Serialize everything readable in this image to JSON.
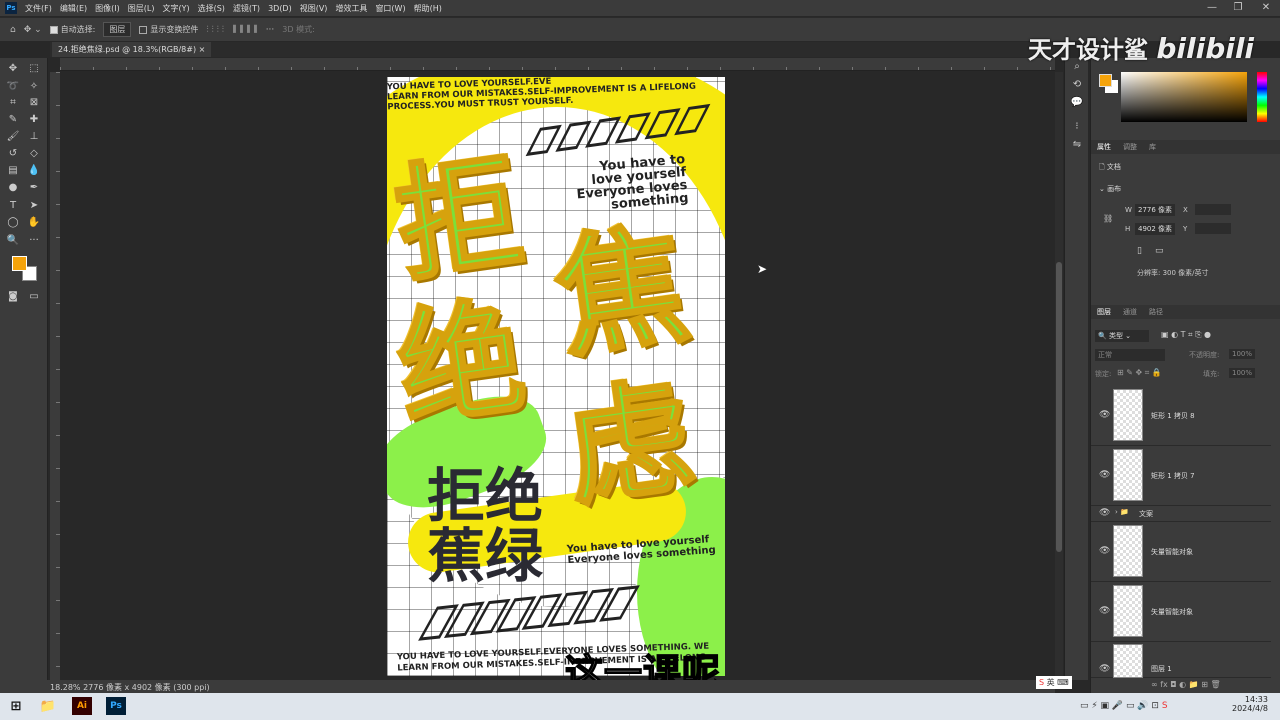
{
  "app": {
    "logo": "Ps"
  },
  "menu": [
    "文件(F)",
    "编辑(E)",
    "图像(I)",
    "图层(L)",
    "文字(Y)",
    "选择(S)",
    "滤镜(T)",
    "3D(D)",
    "视图(V)",
    "增效工具",
    "窗口(W)",
    "帮助(H)"
  ],
  "window_controls": {
    "minimize": "—",
    "restore": "❐",
    "close": "✕"
  },
  "options": {
    "auto_select_label": "自动选择:",
    "auto_select_checked": true,
    "auto_select_target": "图层",
    "show_transform_label": "显示变换控件",
    "show_transform_checked": false,
    "more": "···",
    "mode_3d": "3D 模式:"
  },
  "document_tab": {
    "title": "24.拒绝焦绿.psd @ 18.3%(RGB/8#)",
    "close": "×"
  },
  "artwork": {
    "top_text": [
      "YOU HAVE TO LOVE YOURSELF.EVE",
      "LEARN FROM OUR MISTAKES.SELF-IMPROVEMENT IS A LIFELONG",
      "PROCESS.YOU MUST TRUST YOURSELF."
    ],
    "right_text": [
      "You have to",
      "love yourself",
      "Everyone loves",
      "something"
    ],
    "big_chars": [
      "拒",
      "绝",
      "焦",
      "虑"
    ],
    "dark_title": [
      "拒绝",
      "蕉绿"
    ],
    "mid_text": [
      "You have to love yourself",
      "Everyone loves something"
    ],
    "bottom_text": [
      "YOU HAVE TO LOVE YOURSELF.EVERYONE LOVES SOMETHING. WE",
      "LEARN FROM OUR MISTAKES.SELF-IMPROVEMENT IS A LIFELONG"
    ]
  },
  "subtitle": "这一课呢",
  "watermark": {
    "channel": "天才设计鲨",
    "site": "bilibili"
  },
  "status": {
    "zoom": "18.28%",
    "info": "2776 像素 x 4902 像素 (300 ppi)"
  },
  "colors": {
    "foreground": "#f5a30a",
    "background": "#ffffff"
  },
  "properties": {
    "tabs": [
      "属性",
      "调整",
      "库"
    ],
    "section": "文档",
    "canvas_label": "画布",
    "w_label": "W",
    "w_value": "2776 像素",
    "x_label": "X",
    "h_label": "H",
    "h_value": "4902 像素",
    "y_label": "Y",
    "resolution": "分辨率: 300 像素/英寸"
  },
  "layers_panel": {
    "tabs": [
      "图层",
      "通道",
      "路径"
    ],
    "filter": "类型",
    "blend_mode": "正常",
    "opacity_label": "不透明度:",
    "opacity": "100%",
    "lock_label": "锁定:",
    "fill_label": "填充:",
    "fill": "100%",
    "layers": [
      {
        "name": "矩形 1 拷贝 8",
        "type": "shape"
      },
      {
        "name": "矩形 1 拷贝 7",
        "type": "shape"
      },
      {
        "name": "文案",
        "type": "group"
      },
      {
        "name": "矢量智能对象",
        "type": "smart"
      },
      {
        "name": "矢量智能对象",
        "type": "smart"
      },
      {
        "name": "图层 1",
        "type": "pixel"
      }
    ]
  },
  "taskbar": {
    "apps": [
      "Ai",
      "Ps"
    ],
    "ime": "英",
    "time": "14:33",
    "date": "2024/4/8"
  }
}
